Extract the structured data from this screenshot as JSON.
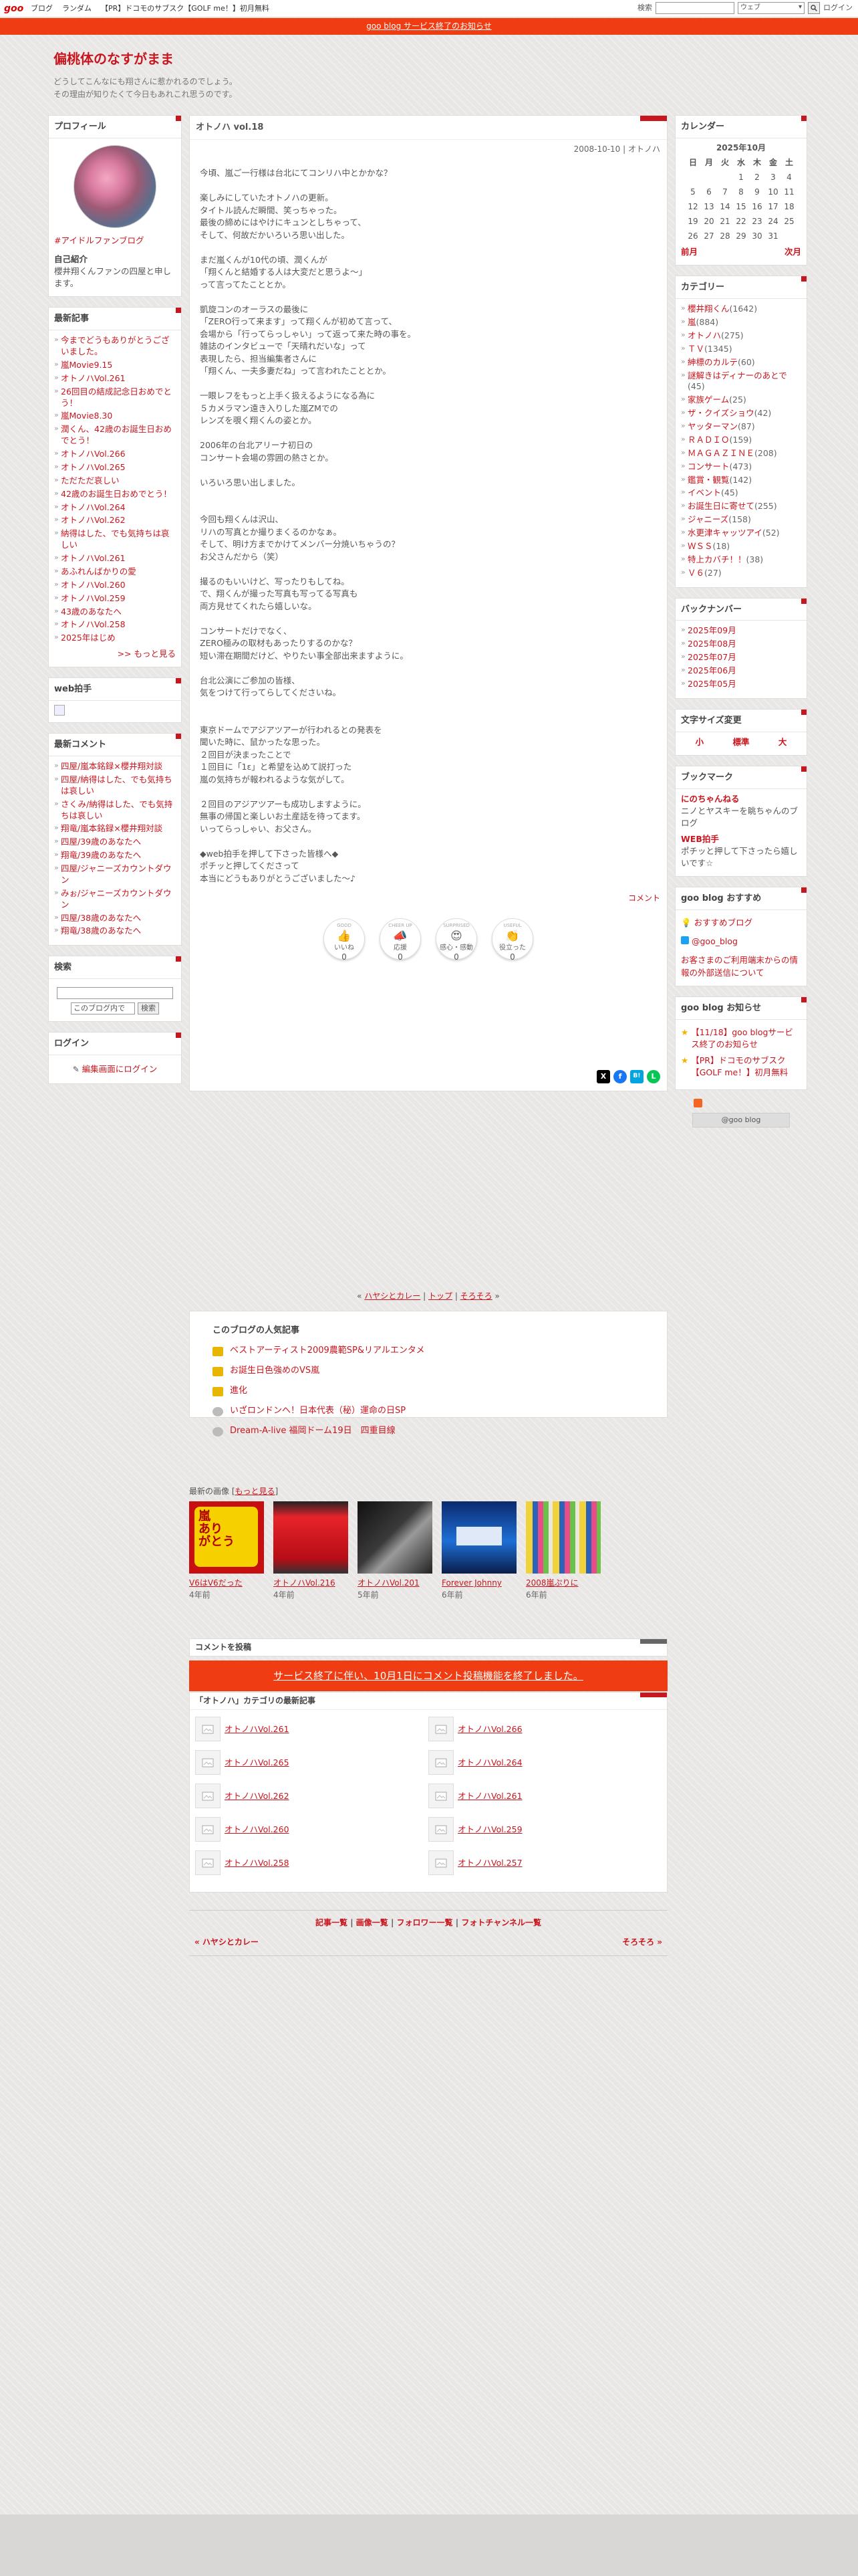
{
  "topbar": {
    "logo": "goo",
    "nav": [
      "ブログ",
      "ランダム",
      "【PR】ドコモのサブスク【GOLF me！】初月無料"
    ],
    "search_label": "検索",
    "select_value": "ウェブ",
    "login": "ログイン"
  },
  "notice": {
    "text": "goo blog サービス終了のお知らせ"
  },
  "blog": {
    "title": "偏桃体のなすがまま",
    "desc1": "どうしてこんなにも翔さんに惹かれるのでしょう。",
    "desc2": "その理由が知りたくて今日もあれこれ思うのです。"
  },
  "profile": {
    "heading": "プロフィール",
    "tag": "#アイドルファンブログ",
    "intro_label": "自己紹介",
    "intro": "櫻井翔くんファンの四屋と申します。"
  },
  "recent_posts": {
    "heading": "最新記事",
    "items": [
      "今までどうもありがとうございました。",
      "嵐Movie9.15",
      "オトノハVol.261",
      "26回目の結成記念日おめでとう！",
      "嵐Movie8.30",
      "潤くん、42歳のお誕生日おめでとう！",
      "オトノハVol.266",
      "オトノハVol.265",
      "ただただ哀しい",
      "42歳のお誕生日おめでとう！",
      "オトノハVol.264",
      "オトノハVol.262",
      "納得はした、でも気持ちは哀しい",
      "オトノハVol.261",
      "あふれんばかりの愛",
      "オトノハVol.260",
      "オトノハVol.259",
      "43歳のあなたへ",
      "オトノハVol.258",
      "2025年はじめ"
    ],
    "more": ">> もっと見る"
  },
  "webclap": {
    "heading": "web拍手"
  },
  "recent_comments": {
    "heading": "最新コメント",
    "items": [
      "四屋/嵐本銘録×櫻井翔対談",
      "四屋/納得はした、でも気持ちは哀しい",
      "さくみ/納得はした、でも気持ちは哀しい",
      "翔竜/嵐本銘録×櫻井翔対談",
      "四屋/39歳のあなたへ",
      "翔竜/39歳のあなたへ",
      "四屋/ジャニーズカウントダウン",
      "みぉ/ジャニーズカウントダウン",
      "四屋/38歳のあなたへ",
      "翔竜/38歳のあなたへ"
    ]
  },
  "search": {
    "heading": "検索",
    "select": "このブログ内で",
    "button": "検索"
  },
  "login": {
    "heading": "ログイン",
    "link": "編集画面にログイン"
  },
  "entry": {
    "title": "オトノハ vol.18",
    "meta": "2008-10-10 | オトノハ",
    "body": "今頃、嵐ご一行様は台北にてコンリハ中とかかな？\n\n楽しみにしていたオトノハの更新。\nタイトル読んだ瞬間、笑っちゃった。\n最後の締めにはやけにキュンとしちゃって、\nそして、何故だかいろいろ思い出した。\n\nまだ嵐くんが10代の頃、潤くんが\n「翔くんと結婚する人は大変だと思うよ～」\nって言ってたこととか。\n\n凱旋コンのオーラスの最後に\n「ZERO行って来ます」って翔くんが初めて言って、\n会場から「行ってらっしゃい」って返って来た時の事を。\n雑誌のインタビューで「天晴れだいな」って\n表現したら、担当編集者さんに\n「翔くん、一夫多妻だね」って言われたこととか。\n\n一眼レフをもっと上手く扱えるようになる為に\n５カメラマン遠き入りした嵐ZMでの\nレンズを覗く翔くんの姿とか。\n\n2006年の台北アリーナ初日の\nコンサート会場の雰囲の熱さとか。\n\nいろいろ思い出しました。\n\n\n今回も翔くんは沢山、\nリハの写真とか撮りまくるのかなぁ。\nそして、明け方までかけてメンバー分焼いちゃうの？\nお父さんだから（笑）\n\n撮るのもいいけど、写ったりもしてね。\nで、翔くんが撮った写真も写ってる写真も\n両方見せてくれたら嬉しいな。\n\nコンサートだけでなく、\nZERO極みの取材もあったりするのかな？\n短い滞在期間だけど、やりたい事全部出来ますように。\n\n台北公演にご参加の皆様、\n気をつけて行ってらしてくださいね。\n\n\n東京ドームでアジアツアーが行われるとの発表を\n聞いた時に、鼠かったな思った。\n２回目が決まったことで\n１回目に「1ε」と希望を込めて説打った\n嵐の気持ちが報われるような気がして。\n\n２回目のアジアツアーも成功しますように。\n無事の帰国と楽しいお土産話を待ってます。\nいってらっしゃい、お父さん。\n\n◆web拍手を押して下さった皆様へ◆\nポチッと押してくださって\n本当にどうもありがとうございました～♪",
    "comment_link": "コメント"
  },
  "reactions": [
    {
      "label": "いいね",
      "top": "GOOD",
      "emoji": "👍",
      "count": "0"
    },
    {
      "label": "応援",
      "top": "CHEER UP",
      "emoji": "📣",
      "count": "0"
    },
    {
      "label": "感心・感動",
      "top": "SURPRISED",
      "emoji": "😍",
      "count": "0"
    },
    {
      "label": "役立った",
      "top": "USEFUL",
      "emoji": "👏",
      "count": "0"
    }
  ],
  "share": [
    "X",
    "f",
    "B!",
    "L"
  ],
  "calendar": {
    "heading": "カレンダー",
    "month": "2025年10月",
    "days": [
      "日",
      "月",
      "火",
      "水",
      "木",
      "金",
      "土"
    ],
    "weeks": [
      [
        "",
        "",
        "",
        "1",
        "2",
        "3",
        "4"
      ],
      [
        "5",
        "6",
        "7",
        "8",
        "9",
        "10",
        "11"
      ],
      [
        "12",
        "13",
        "14",
        "15",
        "16",
        "17",
        "18"
      ],
      [
        "19",
        "20",
        "21",
        "22",
        "23",
        "24",
        "25"
      ],
      [
        "26",
        "27",
        "28",
        "29",
        "30",
        "31",
        ""
      ]
    ],
    "prev": "前月",
    "next": "次月"
  },
  "categories": {
    "heading": "カテゴリー",
    "items": [
      {
        "name": "櫻井翔くん",
        "count": "(1642)"
      },
      {
        "name": "嵐",
        "count": "(884)"
      },
      {
        "name": "オトノハ",
        "count": "(275)"
      },
      {
        "name": "ＴＶ",
        "count": "(1345)"
      },
      {
        "name": "紳標のカルテ",
        "count": "(60)"
      },
      {
        "name": "謎解きはディナーのあとで",
        "count": "(45)"
      },
      {
        "name": "家族ゲーム",
        "count": "(25)"
      },
      {
        "name": "ザ・クイズショウ",
        "count": "(42)"
      },
      {
        "name": "ヤッターマン",
        "count": "(87)"
      },
      {
        "name": "ＲＡＤＩＯ",
        "count": "(159)"
      },
      {
        "name": "ＭＡＧＡＺＩＮＥ",
        "count": "(208)"
      },
      {
        "name": "コンサート",
        "count": "(473)"
      },
      {
        "name": "鑑賞・観覧",
        "count": "(142)"
      },
      {
        "name": "イベント",
        "count": "(45)"
      },
      {
        "name": "お誕生日に寄せて",
        "count": "(255)"
      },
      {
        "name": "ジャニーズ",
        "count": "(158)"
      },
      {
        "name": "水更津キャッツアイ",
        "count": "(52)"
      },
      {
        "name": "ＷＳＳ",
        "count": "(18)"
      },
      {
        "name": "特上カバチ！！",
        "count": "(38)"
      },
      {
        "name": "Ｖ６",
        "count": "(27)"
      }
    ]
  },
  "backnumber": {
    "heading": "バックナンバー",
    "items": [
      "2025年09月",
      "2025年08月",
      "2025年07月",
      "2025年06月",
      "2025年05月"
    ]
  },
  "fontsize": {
    "heading": "文字サイズ変更",
    "options": [
      "小",
      "標準",
      "大"
    ]
  },
  "bookmark": {
    "heading": "ブックマーク",
    "items": [
      {
        "name": "にのちゃんねる",
        "desc": "ニノとヤスキーを眺ちゃんのブログ"
      },
      {
        "name": "WEB拍手",
        "desc": "ポチッと押して下さったら嬉しいです☆"
      }
    ]
  },
  "goo_recommend": {
    "heading": "goo blog おすすめ",
    "items": [
      "おすすめブログ",
      "@goo_blog"
    ],
    "notice": "お客さまのご利用端末からの情報の外部送信について"
  },
  "goo_news": {
    "heading": "goo blog お知らせ",
    "items": [
      "【11/18】goo blogサービス終了のお知らせ",
      "【PR】ドコモのサブスク【GOLF me！】初月無料"
    ],
    "footer": "@goo blog"
  },
  "pager": {
    "prev": "ハヤシとカレー",
    "top": "トップ",
    "next": "そろそろ"
  },
  "popular": {
    "heading": "このブログの人気記事",
    "items": [
      "ベストアーティスト2009農範SP&リアルエンタメ",
      "お誕生日色強めのVS嵐",
      "進化",
      "いざロンドンへ！日本代表（秘）運命の日SP",
      "Dream-A-live 福岡ドーム19日　四重目線"
    ]
  },
  "recent_images": {
    "heading": "最新の画像",
    "more": "もっと見る",
    "items": [
      {
        "title": "V6はV6だった",
        "ago": "4年前"
      },
      {
        "title": "オトノハVol.216",
        "ago": "4年前"
      },
      {
        "title": "オトノハVol.201",
        "ago": "5年前"
      },
      {
        "title": "Forever Johnny",
        "ago": "6年前"
      },
      {
        "title": "2008嵐ぷりに",
        "ago": "6年前"
      }
    ]
  },
  "comment_post": {
    "heading": "コメントを投稿",
    "banner": "サービス終了に伴い、10月1日にコメント投稿機能を終了しました。"
  },
  "cat_latest": {
    "heading": "「オトノハ」カテゴリの最新記事",
    "items": [
      "オトノハVol.261",
      "オトノハVol.266",
      "オトノハVol.265",
      "オトノハVol.264",
      "オトノハVol.262",
      "オトノハVol.261",
      "オトノハVol.260",
      "オトノハVol.259",
      "オトノハVol.258",
      "オトノハVol.257"
    ]
  },
  "footer_links": {
    "items": [
      "記事一覧",
      "画像一覧",
      "フォロワー一覧",
      "フォトチャンネル一覧"
    ],
    "prev": "« ハヤシとカレー",
    "next": "そろそろ »"
  }
}
